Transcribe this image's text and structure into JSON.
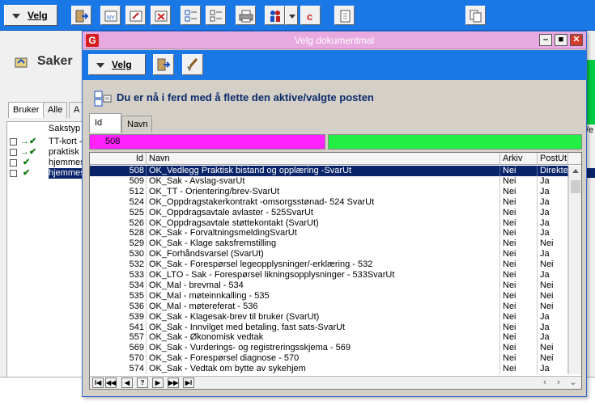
{
  "app_toolbar": {
    "velg_label": "Velg",
    "icons": [
      "exit-icon",
      "new-document-icon",
      "edit-document-icon",
      "delete-document-icon",
      "checklist-icon",
      "unchecked-list-icon",
      "print-icon",
      "people-icon",
      "dropdown-arrow-icon",
      "c-icon",
      "document-add-icon",
      "copy-icon"
    ]
  },
  "background": {
    "title": "Saker",
    "tabs": [
      "Bruker",
      "Alle",
      "A"
    ],
    "list_header": "Sakstyp",
    "rows": [
      {
        "text": "TT-kort -",
        "selected": false
      },
      {
        "text": "praktisk",
        "selected": false
      },
      {
        "text": "hjemmes",
        "selected": false
      },
      {
        "text": "hjemmes",
        "selected": true
      }
    ],
    "right_header": "/e"
  },
  "dialog": {
    "title": "Velg dokumentmal",
    "logo": "G",
    "toolbar_velg_label": "Velg",
    "banner": "Du er nå i ferd med å flette den aktive/valgte posten",
    "sort_tabs": [
      "Id",
      "Navn"
    ],
    "filter_id_value": "508",
    "columns": {
      "id": "Id",
      "navn": "Navn",
      "arkiv": "Arkiv",
      "postut": "PostUt"
    },
    "rows": [
      {
        "id": "508",
        "navn": "OK_Vedlegg Praktisk bistand og opplæring -SvarUt",
        "arkiv": "Nei",
        "postut": "Direkte",
        "selected": true
      },
      {
        "id": "509",
        "navn": "OK_Sak - Avslag-svarUt",
        "arkiv": "Nei",
        "postut": "Ja"
      },
      {
        "id": "512",
        "navn": "OK_TT - Orientering/brev-SvarUt",
        "arkiv": "Nei",
        "postut": "Ja"
      },
      {
        "id": "524",
        "navn": "OK_Oppdragstakerkontrakt -omsorgsstønad- 524 SvarUt",
        "arkiv": "Nei",
        "postut": "Ja"
      },
      {
        "id": "525",
        "navn": "OK_Oppdragsavtale avlaster - 525SvarUt",
        "arkiv": "Nei",
        "postut": "Ja"
      },
      {
        "id": "526",
        "navn": "OK_Oppdragsavtale støttekontakt (SvarUt)",
        "arkiv": "Nei",
        "postut": "Ja"
      },
      {
        "id": "528",
        "navn": "OK_Sak - ForvaltningsmeldingSvarUt",
        "arkiv": "Nei",
        "postut": "Ja"
      },
      {
        "id": "529",
        "navn": "OK_Sak - Klage saksfremstilling",
        "arkiv": "Nei",
        "postut": "Nei"
      },
      {
        "id": "530",
        "navn": "OK_Forhåndsvarsel (SvarUt)",
        "arkiv": "Nei",
        "postut": "Ja"
      },
      {
        "id": "532",
        "navn": "OK_Sak - Forespørsel legeopplysninger/-erklæring - 532",
        "arkiv": "Nei",
        "postut": "Nei"
      },
      {
        "id": "533",
        "navn": "OK_LTO - Sak - Forespørsel likningsopplysninger - 533SvarUt",
        "arkiv": "Nei",
        "postut": "Ja"
      },
      {
        "id": "534",
        "navn": "OK_Mal - brevmal - 534",
        "arkiv": "Nei",
        "postut": "Nei"
      },
      {
        "id": "535",
        "navn": "OK_Mal - møteinnkalling - 535",
        "arkiv": "Nei",
        "postut": "Nei"
      },
      {
        "id": "536",
        "navn": "OK_Mal - møtereferat - 536",
        "arkiv": "Nei",
        "postut": "Nei"
      },
      {
        "id": "539",
        "navn": "OK_Sak - Klagesak-brev til bruker (SvarUt)",
        "arkiv": "Nei",
        "postut": "Ja"
      },
      {
        "id": "541",
        "navn": "OK_Sak - Innvilget med betaling, fast sats-SvarUt",
        "arkiv": "Nei",
        "postut": "Ja"
      },
      {
        "id": "557",
        "navn": "OK_Sak - Økonomisk vedtak",
        "arkiv": "Nei",
        "postut": "Ja"
      },
      {
        "id": "569",
        "navn": "OK_Sak - Vurderings- og registreringsskjema - 569",
        "arkiv": "Nei",
        "postut": "Nei"
      },
      {
        "id": "570",
        "navn": "OK_Sak - Forespørsel diagnose - 570",
        "arkiv": "Nei",
        "postut": "Nei"
      },
      {
        "id": "574",
        "navn": "OK_Sak - Vedtak om bytte av sykehjem",
        "arkiv": "Nei",
        "postut": "Ja"
      }
    ],
    "nav_buttons": [
      "I◀",
      "◀◀",
      "◀",
      "?",
      "▶",
      "▶▶",
      "▶I"
    ]
  },
  "colors": {
    "toolbar_blue": "#1a78e6",
    "dialog_title_pink": "#e8a8e0",
    "filter_magenta": "#ff22ff",
    "filter_green": "#22ee44",
    "selection_navy": "#0a246a"
  }
}
